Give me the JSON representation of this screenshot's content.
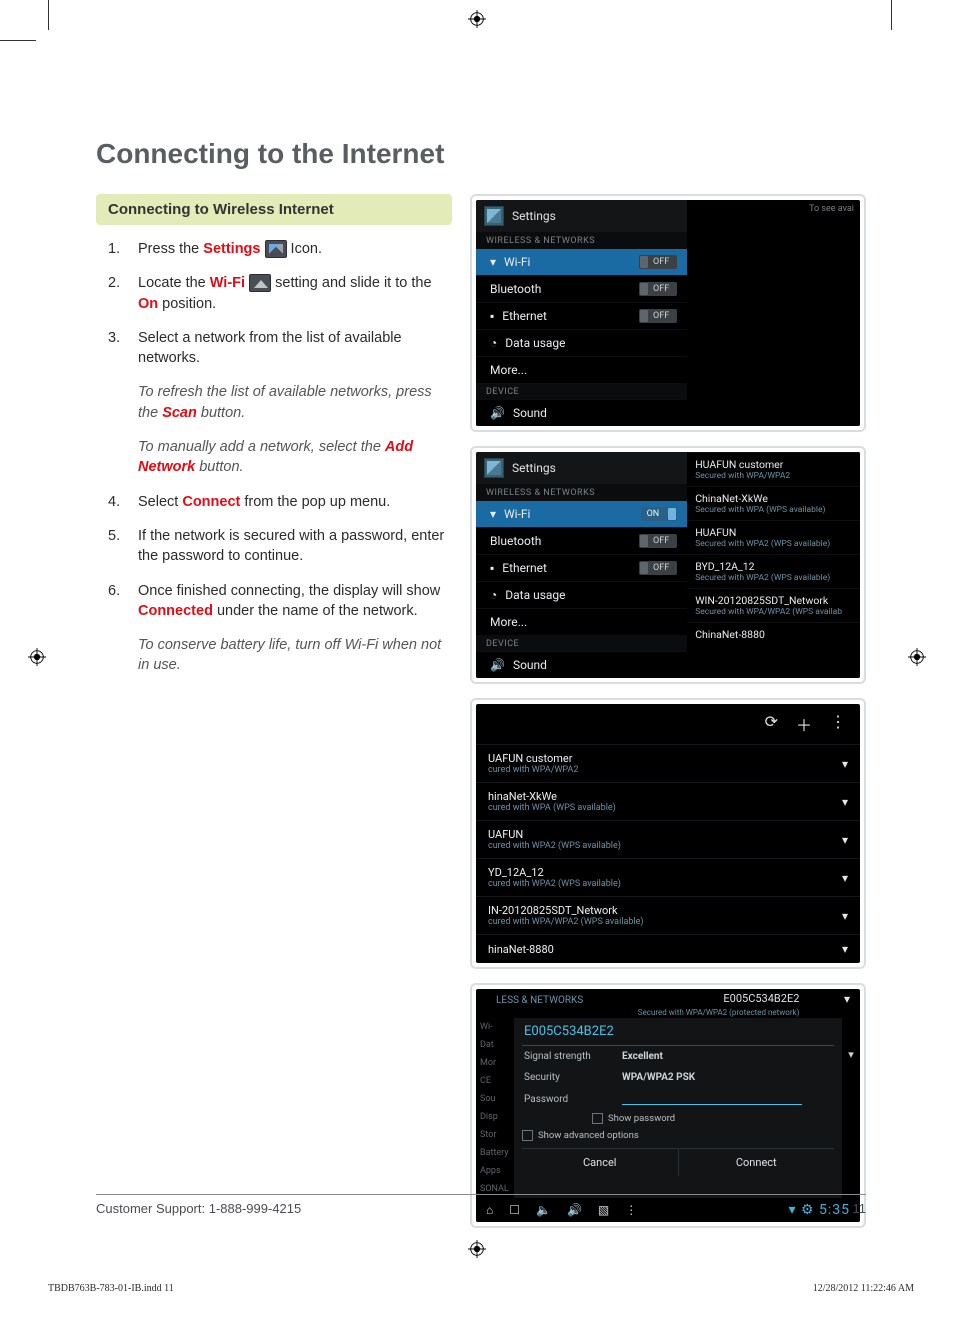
{
  "page_title": "Connecting to the Internet",
  "ribbon": "Connecting to Wireless Internet",
  "steps": {
    "s1a": "Press the ",
    "s1_settings": "Settings",
    "s1b": " Icon.",
    "s2a": "Locate the ",
    "s2_wifi": "Wi-Fi",
    "s2b": " setting and slide it to the ",
    "s2_on": "On",
    "s2c": " position.",
    "s3": "Select a network from the list of available networks.",
    "s4a": "Select ",
    "s4_connect": "Connect",
    "s4b": " from the pop up menu.",
    "s5": "If the network is secured with a password, enter the password to continue.",
    "s6a": "Once finished connecting, the display will show ",
    "s6_connected": "Connected",
    "s6b": " under the name of the network."
  },
  "notes": {
    "n1a": "To refresh the list of available networks, press the ",
    "n1_scan": "Scan",
    "n1b": " button.",
    "n2a": "To manually add a network, select the ",
    "n2_add": "Add Network",
    "n2b": " button.",
    "n3": "To conserve battery life, turn off Wi-Fi when not in use."
  },
  "screens": {
    "s1": {
      "title": "Settings",
      "sec1": "WIRELESS & NETWORKS",
      "wifi": "Wi-Fi",
      "wifi_state": "OFF",
      "bt": "Bluetooth",
      "bt_state": "OFF",
      "eth": "Ethernet",
      "eth_state": "OFF",
      "data": "Data usage",
      "more": "More...",
      "sec2": "DEVICE",
      "sound": "Sound",
      "to_see": "To see avai"
    },
    "s2": {
      "title": "Settings",
      "sec1": "WIRELESS & NETWORKS",
      "wifi": "Wi-Fi",
      "wifi_state": "ON",
      "bt": "Bluetooth",
      "bt_state": "OFF",
      "eth": "Ethernet",
      "eth_state": "OFF",
      "data": "Data usage",
      "more": "More...",
      "sec2": "DEVICE",
      "sound": "Sound",
      "nets": [
        {
          "n": "HUAFUN customer",
          "s": "Secured with WPA/WPA2"
        },
        {
          "n": "ChinaNet-XkWe",
          "s": "Secured with WPA (WPS available)"
        },
        {
          "n": "HUAFUN",
          "s": "Secured with WPA2 (WPS available)"
        },
        {
          "n": "BYD_12A_12",
          "s": "Secured with WPA2 (WPS available)"
        },
        {
          "n": "WIN-20120825SDT_Network",
          "s": "Secured with WPA/WPA2 (WPS availab"
        },
        {
          "n": "ChinaNet-8880",
          "s": ""
        }
      ]
    },
    "s3": {
      "list": [
        {
          "n": "UAFUN customer",
          "s": "cured with WPA/WPA2"
        },
        {
          "n": "hinaNet-XkWe",
          "s": "cured with WPA (WPS available)"
        },
        {
          "n": "UAFUN",
          "s": "cured with WPA2 (WPS available)"
        },
        {
          "n": "YD_12A_12",
          "s": "cured with WPA2 (WPS available)"
        },
        {
          "n": "IN-20120825SDT_Network",
          "s": "cured with WPA/WPA2 (WPS available)"
        },
        {
          "n": "hinaNet-8880",
          "s": ""
        }
      ]
    },
    "s4": {
      "header_net": "E005C534B2E2",
      "header_sub": "Secured with WPA/WPA2 (protected network)",
      "side": [
        "LESS & NETWORKS",
        "Wi-",
        "Dat",
        "Mor",
        "CE",
        "Sou",
        "Disp",
        "Stor",
        "Battery",
        "Apps",
        "SONAL"
      ],
      "dlg_title": "E005C534B2E2",
      "sig_lab": "Signal strength",
      "sig_val": "Excellent",
      "sec_lab": "Security",
      "sec_val": "WPA/WPA2 PSK",
      "pwd_lab": "Password",
      "show_pwd": "Show password",
      "show_adv": "Show advanced options",
      "cancel": "Cancel",
      "connect": "Connect",
      "clock": "5:35"
    }
  },
  "footer": {
    "support": "Customer Support: 1-888-999-4215",
    "page_no": "11"
  },
  "slug": {
    "file": "TBDB763B-783-01-IB.indd   11",
    "stamp": "12/28/2012   11:22:46 AM"
  }
}
